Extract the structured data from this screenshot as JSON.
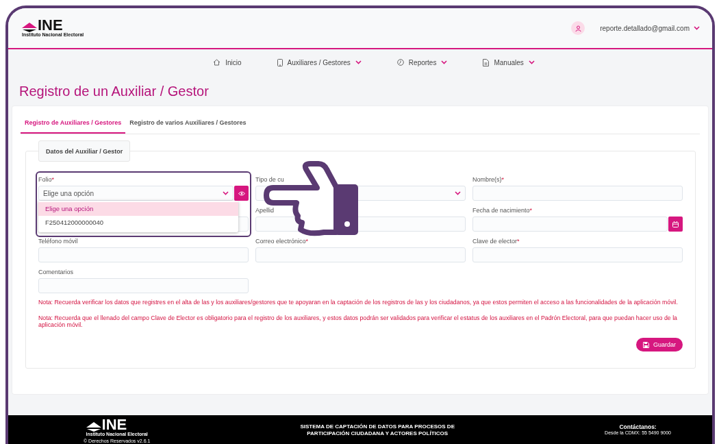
{
  "header": {
    "logo_text": "INE",
    "logo_subtitle": "Instituto Nacional Electoral",
    "user_email": "reporte.detallado@gmail.com"
  },
  "nav": [
    {
      "kind": "home",
      "label": "Inicio",
      "has_menu": false
    },
    {
      "kind": "tablet",
      "label": "Auxiliares / Gestores",
      "has_menu": true
    },
    {
      "kind": "clock",
      "label": "Reportes",
      "has_menu": true
    },
    {
      "kind": "document",
      "label": "Manuales",
      "has_menu": true
    }
  ],
  "page_title": "Registro de un Auxiliar / Gestor",
  "tabs": [
    {
      "label": "Registro de Auxiliares / Gestores",
      "selected": true
    },
    {
      "label": "Registro de varios Auxiliares / Gestores",
      "selected": false
    }
  ],
  "section_title": "Datos del Auxiliar / Gestor",
  "fields": [
    {
      "kind": "select",
      "label": "Folio",
      "required_mark": "*",
      "value": "Elige una opción",
      "highlighted": true,
      "expanded": true,
      "options": [
        {
          "label": "Elige una opción",
          "selected": true
        },
        {
          "label": "F250412000000040",
          "selected": false
        }
      ]
    },
    {
      "kind": "select",
      "label": "Tipo de cu"
    },
    {
      "kind": "text",
      "label": "Nombre(s)",
      "required_mark": "*"
    },
    {
      "kind": "text"
    },
    {
      "kind": "text",
      "label": "Apellid"
    },
    {
      "kind": "date",
      "label": "Fecha de nacimiento",
      "required_mark": "*"
    },
    {
      "kind": "text",
      "label": "Teléfono móvil"
    },
    {
      "kind": "text",
      "label": "Correo electrónico",
      "required_mark": "*"
    },
    {
      "kind": "text",
      "label": "Clave de elector",
      "required_mark": "*"
    },
    {
      "kind": "text",
      "label": "Comentarios"
    }
  ],
  "notes": [
    "Nota: Recuerda verificar los datos que registres en el alta de las y los auxiliares/gestores que te apoyaran en la captación de los registros de las y los ciudadanos, ya que estos permiten el acceso a las funcionalidades de la aplicación móvil.",
    "Nota: Recuerda que el llenado del campo Clave de Elector es obligatorio para el registro de los auxiliares, y estos datos podrán ser validados para verificar el estatus de los auxiliares en el Padrón Electoral, para que puedan hacer uso de la aplicación móvil."
  ],
  "save_button": "Guardar",
  "footer": {
    "logo_text": "INE",
    "logo_subtitle": "Instituto Nacional Electoral",
    "copyright": "© Derechos Reservados v2.6.1",
    "system_title": "SISTEMA DE CAPTACIÓN DE DATOS PARA PROCESOS DE PARTICIPACIÓN CIUDADANA Y ACTORES POLÍTICOS",
    "contact_title": "Contáctanos:",
    "contact_phone": "Desde la CDMX: 55 5490 9000"
  }
}
